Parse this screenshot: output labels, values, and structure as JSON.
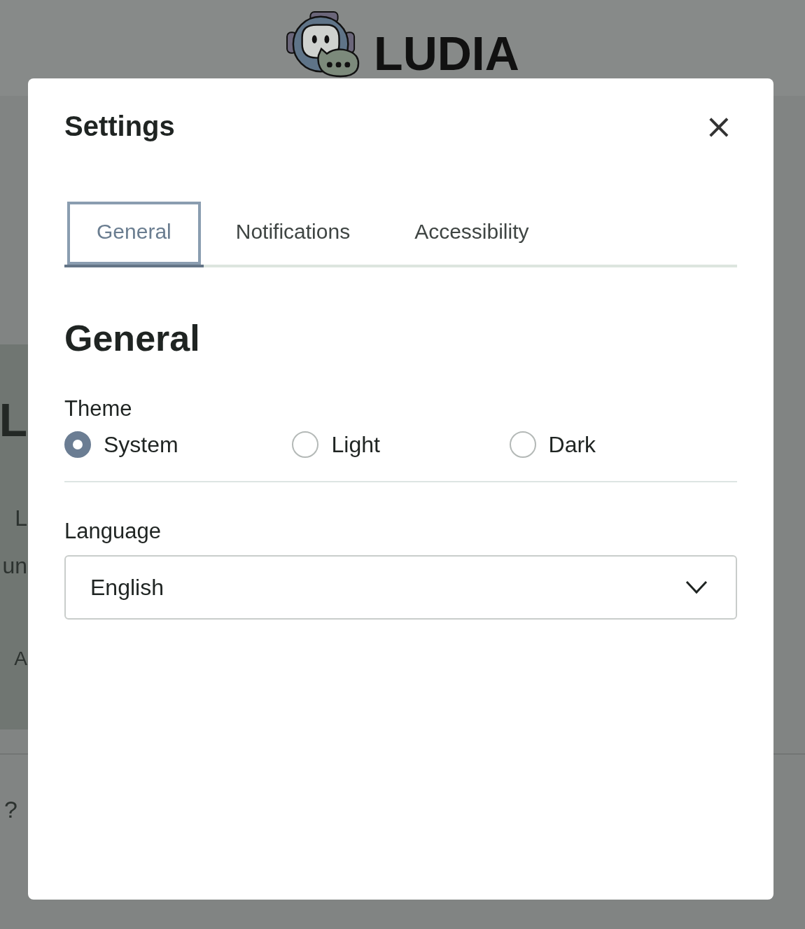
{
  "header": {
    "brand": "LUDIA"
  },
  "background_fragments": {
    "hero_heading": "L",
    "lines": [
      "L",
      "un",
      "A"
    ],
    "footer_text": "?"
  },
  "dialog": {
    "title": "Settings",
    "close": "×",
    "tabs": [
      {
        "label": "General",
        "selected": true
      },
      {
        "label": "Notifications",
        "selected": false
      },
      {
        "label": "Accessibility",
        "selected": false
      }
    ],
    "section_title": "General",
    "theme": {
      "label": "Theme",
      "options": [
        {
          "label": "System",
          "selected": true
        },
        {
          "label": "Light",
          "selected": false
        },
        {
          "label": "Dark",
          "selected": false
        }
      ]
    },
    "language": {
      "label": "Language",
      "value": "English"
    }
  }
}
